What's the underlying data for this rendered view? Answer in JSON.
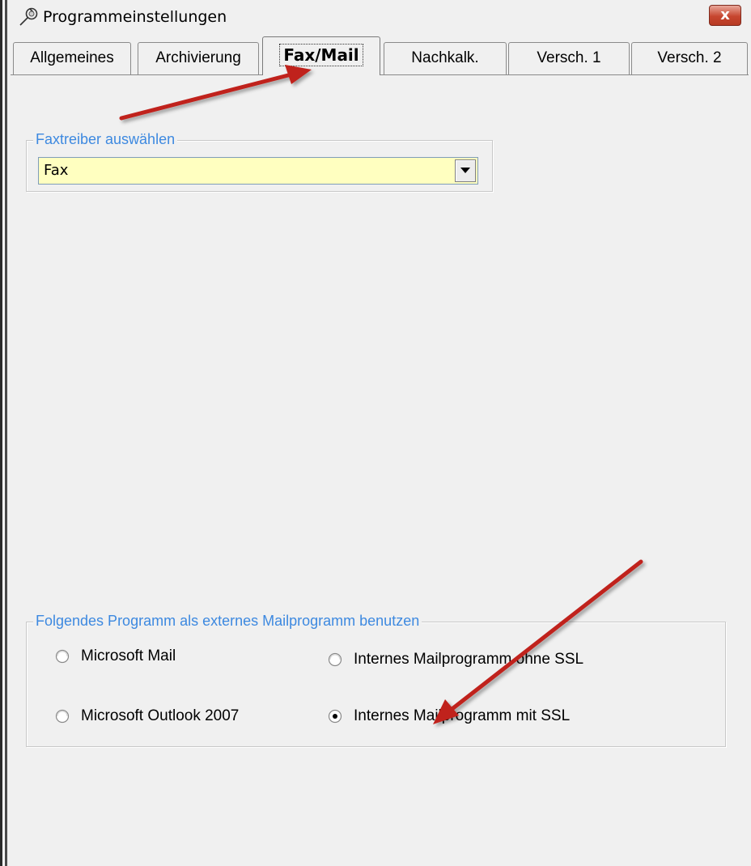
{
  "window": {
    "title": "Programmeinstellungen",
    "close_label": "x",
    "title_icon": "wrench-icon"
  },
  "tabs": [
    {
      "label": "Allgemeines",
      "active": false
    },
    {
      "label": "Archivierung",
      "active": false
    },
    {
      "label": "Fax/Mail",
      "active": true
    },
    {
      "label": "Nachkalk.",
      "active": false
    },
    {
      "label": "Versch. 1",
      "active": false
    },
    {
      "label": "Versch. 2",
      "active": false
    }
  ],
  "fax_group": {
    "title": "Faxtreiber auswählen",
    "selected_value": "Fax",
    "field_color": "#ffffc0"
  },
  "mail_group": {
    "title": "Folgendes Programm als externes Mailprogramm benutzen",
    "options": [
      {
        "label": "Microsoft Mail",
        "checked": false
      },
      {
        "label": "Internes Mailprogramm ohne SSL",
        "checked": false
      },
      {
        "label": "Microsoft Outlook 2007",
        "checked": false
      },
      {
        "label": "Internes Mailprogramm mit SSL",
        "checked": true
      }
    ]
  },
  "colors": {
    "group_title": "#3d89e0",
    "annotation_arrow": "#c0201c"
  }
}
